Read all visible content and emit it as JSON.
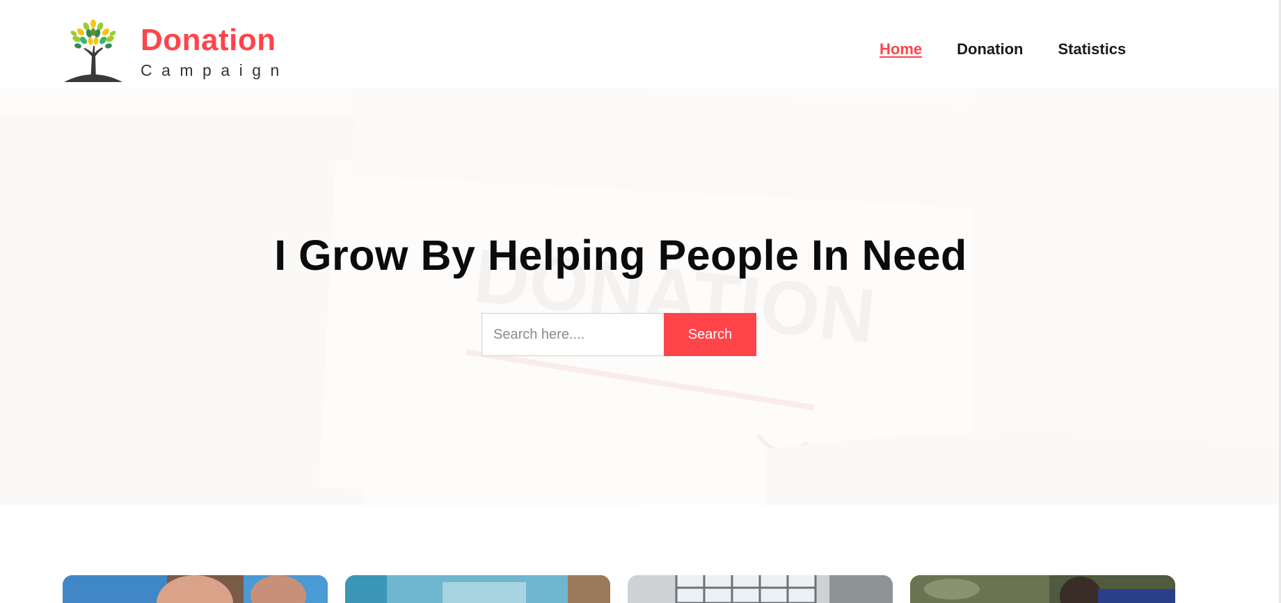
{
  "brand": {
    "title": "Donation",
    "subtitle": "Campaign",
    "accent_color": "#FF444A"
  },
  "nav": {
    "items": [
      {
        "label": "Home",
        "active": true
      },
      {
        "label": "Donation",
        "active": false
      },
      {
        "label": "Statistics",
        "active": false
      }
    ]
  },
  "hero": {
    "title": "I Grow By Helping People In Need",
    "search_placeholder": "Search here....",
    "search_button": "Search",
    "background_icon": "donation-box-photo"
  },
  "cards": [
    {
      "image": "volunteers-photo"
    },
    {
      "image": "blue-wall-photo"
    },
    {
      "image": "window-room-photo"
    },
    {
      "image": "outdoor-people-photo"
    }
  ]
}
